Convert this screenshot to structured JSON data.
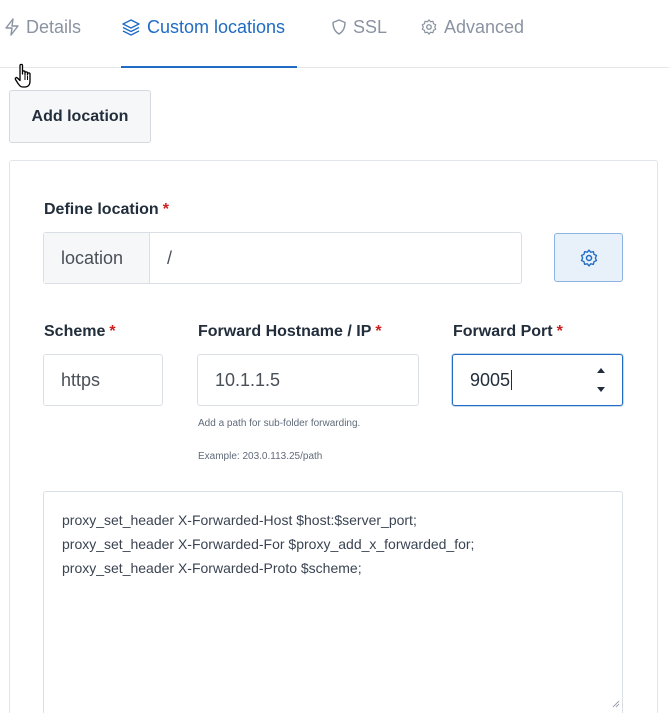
{
  "tabs": {
    "details": "Details",
    "custom_locations": "Custom locations",
    "ssl": "SSL",
    "advanced": "Advanced",
    "active": "custom_locations"
  },
  "toolbar": {
    "add_location_label": "Add location"
  },
  "location": {
    "label": "Define location",
    "required_mark": "*",
    "prefix": "location",
    "value": "/"
  },
  "scheme": {
    "label": "Scheme",
    "required_mark": "*",
    "value": "https"
  },
  "forward_host": {
    "label": "Forward Hostname / IP",
    "required_mark": "*",
    "value": "10.1.1.5",
    "hint_1": "Add a path for sub-folder forwarding.",
    "hint_2": "Example: 203.0.113.25/path"
  },
  "forward_port": {
    "label": "Forward Port",
    "required_mark": "*",
    "value": "9005"
  },
  "advanced_config": {
    "lines": [
      "proxy_set_header X-Forwarded-Host $host:$server_port;",
      "proxy_set_header X-Forwarded-For $proxy_add_x_forwarded_for;",
      "proxy_set_header X-Forwarded-Proto $scheme;"
    ]
  },
  "colors": {
    "accent": "#206bc4",
    "required": "#cd201f",
    "muted_text": "#8a93a2"
  },
  "icons": {
    "details": "bolt-icon",
    "custom_locations": "layers-icon",
    "ssl": "shield-icon",
    "advanced": "gear-icon",
    "location_settings": "gear-icon"
  }
}
